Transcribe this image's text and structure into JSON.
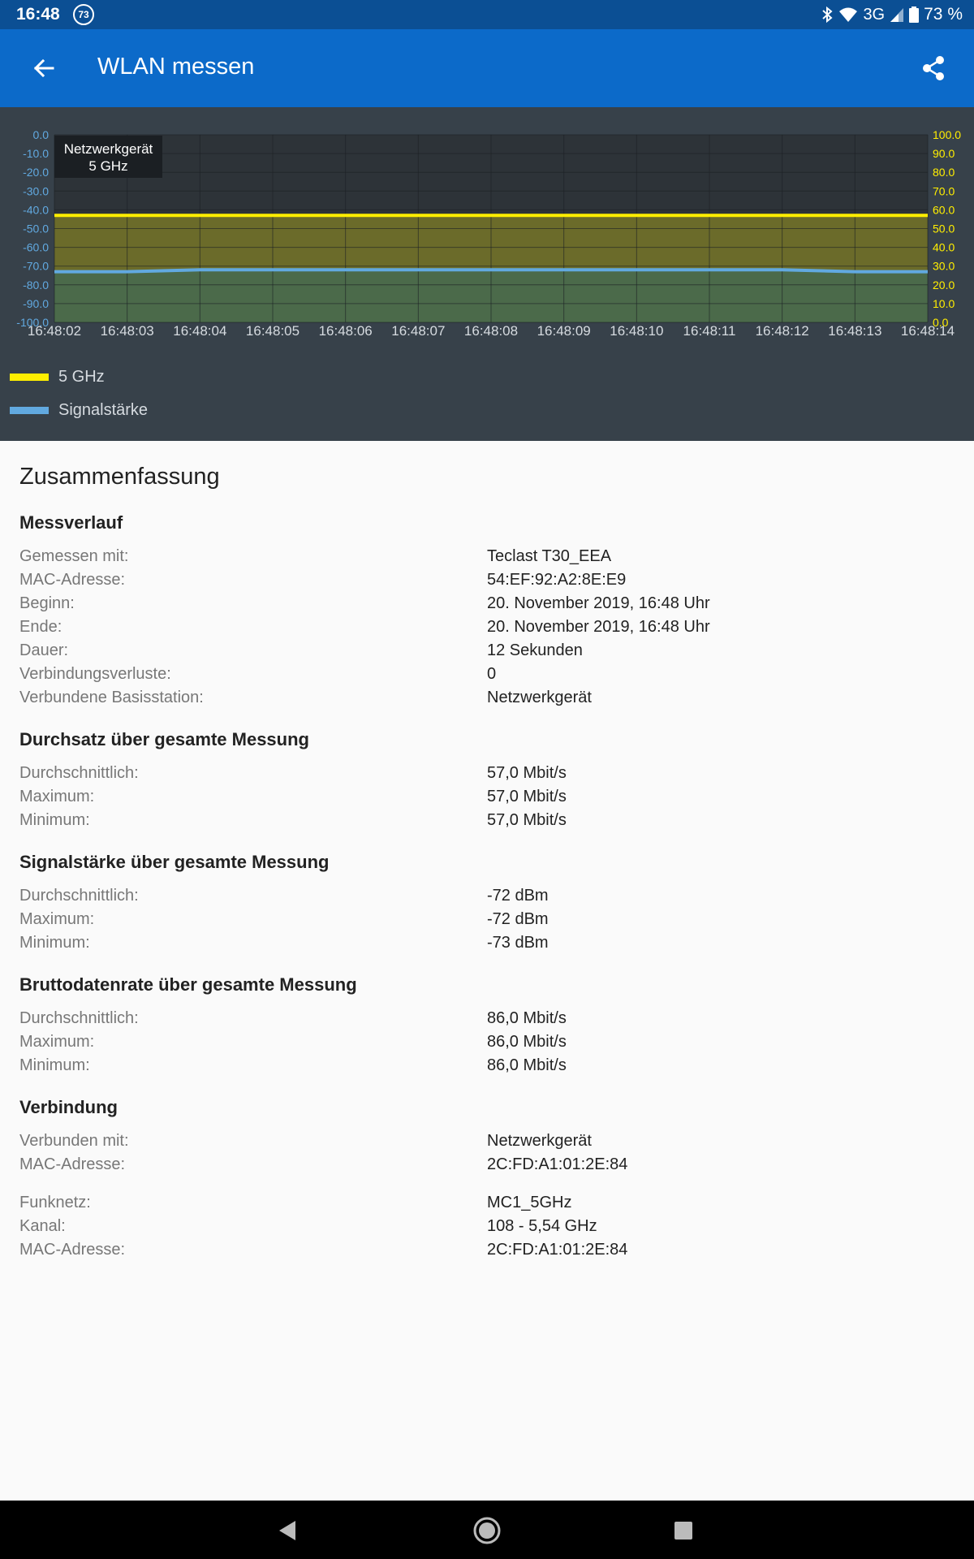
{
  "status": {
    "time": "16:48",
    "notification_badge": "73",
    "network": "3G",
    "battery": "73 %"
  },
  "app_bar": {
    "title": "WLAN messen",
    "back_icon": "arrow-left-icon",
    "share_icon": "share-icon"
  },
  "chart_data": {
    "type": "line",
    "x": [
      "16:48:02",
      "16:48:03",
      "16:48:04",
      "16:48:05",
      "16:48:06",
      "16:48:07",
      "16:48:08",
      "16:48:09",
      "16:48:10",
      "16:48:11",
      "16:48:12",
      "16:48:13",
      "16:48:14"
    ],
    "y_left_ticks": [
      "0.0",
      "-10.0",
      "-20.0",
      "-30.0",
      "-40.0",
      "-50.0",
      "-60.0",
      "-70.0",
      "-80.0",
      "-90.0",
      "-100.0"
    ],
    "y_right_ticks": [
      "100.0",
      "90.0",
      "80.0",
      "70.0",
      "60.0",
      "50.0",
      "40.0",
      "30.0",
      "20.0",
      "10.0",
      "0.0"
    ],
    "y_left_range": [
      -100,
      0
    ],
    "y_right_range": [
      0,
      100
    ],
    "grid": true,
    "legend_position": "bottom-left",
    "series": [
      {
        "name": "5 GHz",
        "axis": "right",
        "color": "#ffee00",
        "fill": "#6b6b2a",
        "values": [
          57,
          57,
          57,
          57,
          57,
          57,
          57,
          57,
          57,
          57,
          57,
          57,
          57
        ]
      },
      {
        "name": "Signalstärke",
        "axis": "left",
        "color": "#61a9e0",
        "fill": "#4b6a4a",
        "values": [
          -73,
          -73,
          -72,
          -72,
          -72,
          -72,
          -72,
          -72,
          -72,
          -72,
          -72,
          -73,
          -73
        ]
      }
    ],
    "tooltip": {
      "line1": "Netzwerkgerät",
      "line2": "5 GHz"
    }
  },
  "summary": {
    "title": "Zusammenfassung",
    "sections": [
      {
        "heading": "Messverlauf",
        "rows": [
          {
            "label": "Gemessen mit:",
            "value": "Teclast T30_EEA"
          },
          {
            "label": "MAC-Adresse:",
            "value": "54:EF:92:A2:8E:E9"
          },
          {
            "label": "Beginn:",
            "value": "20. November 2019, 16:48 Uhr"
          },
          {
            "label": "Ende:",
            "value": "20. November 2019, 16:48 Uhr"
          },
          {
            "label": "Dauer:",
            "value": "12 Sekunden"
          },
          {
            "label": "Verbindungsverluste:",
            "value": "0"
          },
          {
            "label": "Verbundene Basisstation:",
            "value": "Netzwerkgerät"
          }
        ]
      },
      {
        "heading": "Durchsatz über gesamte Messung",
        "rows": [
          {
            "label": "Durchschnittlich:",
            "value": "57,0 Mbit/s"
          },
          {
            "label": "Maximum:",
            "value": "57,0 Mbit/s"
          },
          {
            "label": "Minimum:",
            "value": "57,0 Mbit/s"
          }
        ]
      },
      {
        "heading": "Signalstärke über gesamte Messung",
        "rows": [
          {
            "label": "Durchschnittlich:",
            "value": "-72 dBm"
          },
          {
            "label": "Maximum:",
            "value": "-72 dBm"
          },
          {
            "label": "Minimum:",
            "value": "-73 dBm"
          }
        ]
      },
      {
        "heading": "Bruttodatenrate über gesamte Messung",
        "rows": [
          {
            "label": "Durchschnittlich:",
            "value": "86,0 Mbit/s"
          },
          {
            "label": "Maximum:",
            "value": "86,0 Mbit/s"
          },
          {
            "label": "Minimum:",
            "value": "86,0 Mbit/s"
          }
        ]
      },
      {
        "heading": "Verbindung",
        "rows": [
          {
            "label": "Verbunden mit:",
            "value": "Netzwerkgerät"
          },
          {
            "label": "MAC-Adresse:",
            "value": "2C:FD:A1:01:2E:84"
          },
          {
            "label": "Funknetz:",
            "value": "MC1_5GHz"
          },
          {
            "label": "Kanal:",
            "value": "108 - 5,54 GHz"
          },
          {
            "label": "MAC-Adresse:",
            "value": "2C:FD:A1:01:2E:84"
          }
        ]
      }
    ]
  },
  "nav": {
    "back_icon": "nav-back-icon",
    "home_icon": "nav-home-icon",
    "recents_icon": "nav-recents-icon"
  }
}
